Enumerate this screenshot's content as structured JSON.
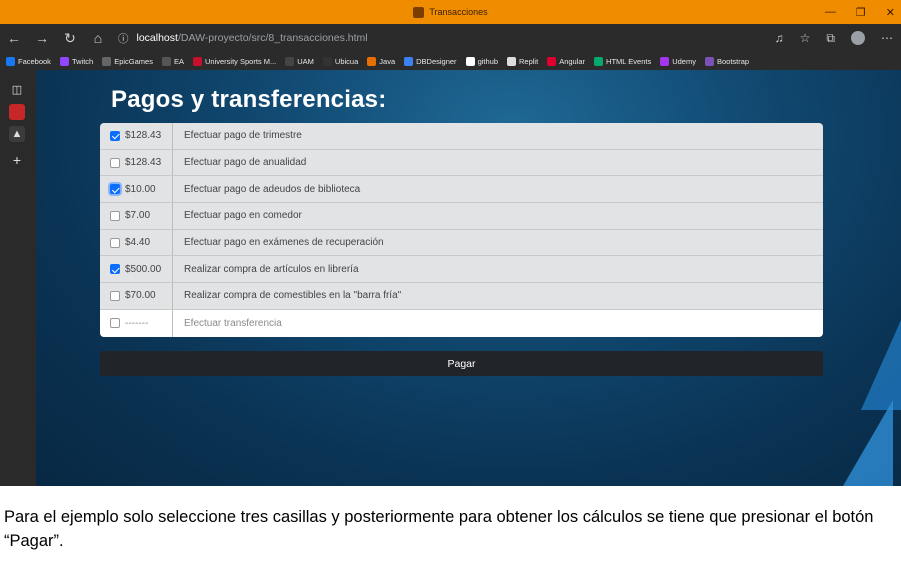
{
  "window": {
    "title": "Transacciones"
  },
  "address": {
    "host": "localhost",
    "path": "/DAW-proyecto/src/8_transacciones.html"
  },
  "bookmarks": [
    {
      "label": "Facebook",
      "color": "#1877f2"
    },
    {
      "label": "Twitch",
      "color": "#9146ff"
    },
    {
      "label": "EpicGames",
      "color": "#666666"
    },
    {
      "label": "EA",
      "color": "#555555"
    },
    {
      "label": "University Sports M...",
      "color": "#c8102e"
    },
    {
      "label": "UAM",
      "color": "#444444"
    },
    {
      "label": "Ubicua",
      "color": "#333333"
    },
    {
      "label": "Java",
      "color": "#e76f00"
    },
    {
      "label": "DBDesigner",
      "color": "#3b82f6"
    },
    {
      "label": "github",
      "color": "#ffffff"
    },
    {
      "label": "Replit",
      "color": "#dddddd"
    },
    {
      "label": "Angular",
      "color": "#dd0031"
    },
    {
      "label": "HTML Events",
      "color": "#04aa6d"
    },
    {
      "label": "Udemy",
      "color": "#a435f0"
    },
    {
      "label": "Bootstrap",
      "color": "#7952b3"
    }
  ],
  "page": {
    "title": "Pagos y transferencias:",
    "items": [
      {
        "amount": "$128.43",
        "desc": "Efectuar pago de trimestre",
        "checked": true
      },
      {
        "amount": "$128.43",
        "desc": "Efectuar pago de anualidad",
        "checked": false
      },
      {
        "amount": "$10.00",
        "desc": "Efectuar pago de adeudos de biblioteca",
        "checked": true
      },
      {
        "amount": "$7.00",
        "desc": "Efectuar pago en comedor",
        "checked": false
      },
      {
        "amount": "$4.40",
        "desc": "Efectuar pago en exámenes de recuperación",
        "checked": false
      },
      {
        "amount": "$500.00",
        "desc": "Realizar compra de artículos en librería",
        "checked": true
      },
      {
        "amount": "$70.00",
        "desc": "Realizar compra de comestibles en la \"barra fría\"",
        "checked": false
      },
      {
        "amount": "-------",
        "desc": "Efectuar transferencia",
        "checked": false
      }
    ],
    "pay_label": "Pagar"
  },
  "caption": "Para el ejemplo solo seleccione tres casillas y posteriormente para obtener los cálculos se tiene que presionar el botón “Pagar”."
}
